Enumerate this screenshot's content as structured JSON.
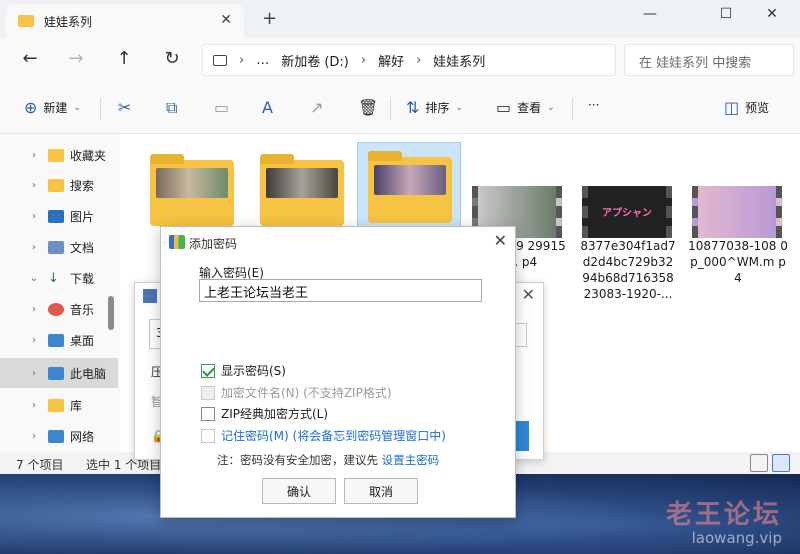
{
  "window": {
    "tab_title": "娃娃系列",
    "tab_close": "✕",
    "new_tab": "+"
  },
  "window_controls": {
    "minimize": "—",
    "maximize": "☐",
    "close": "✕"
  },
  "navigation": {
    "back": "←",
    "forward": "→",
    "up": "↑",
    "refresh": "↻"
  },
  "address": {
    "more": "…",
    "separator": "›",
    "path": [
      "新加卷 (D:)",
      "解好",
      "娃娃系列"
    ],
    "search_placeholder": "在 娃娃系列 中搜索"
  },
  "toolbar": {
    "new_label": "新建",
    "sort_label": "排序",
    "view_label": "查看",
    "more_label": "···",
    "preview_label": "预览",
    "cut_icon": "cut-icon",
    "copy_icon": "copy-icon",
    "paste_icon": "paste-icon",
    "rename_icon": "rename-icon",
    "share_icon": "share-icon",
    "delete_icon": "delete-icon"
  },
  "sidebar": {
    "items": [
      {
        "label": "收藏夹",
        "icon": "folder-icon",
        "expanded": false
      },
      {
        "label": "搜索",
        "icon": "folder-icon",
        "expanded": false
      },
      {
        "label": "图片",
        "icon": "pictures-icon",
        "expanded": false
      },
      {
        "label": "文档",
        "icon": "documents-icon",
        "expanded": false
      },
      {
        "label": "下载",
        "icon": "downloads-icon",
        "expanded": true
      },
      {
        "label": "音乐",
        "icon": "music-icon",
        "expanded": false
      },
      {
        "label": "桌面",
        "icon": "desktop-icon",
        "expanded": false
      },
      {
        "label": "此电脑",
        "icon": "pc-icon",
        "expanded": false,
        "selected": true
      },
      {
        "label": "库",
        "icon": "library-icon",
        "expanded": false
      },
      {
        "label": "网络",
        "icon": "network-icon",
        "expanded": false
      }
    ]
  },
  "files": {
    "folders": [
      {
        "type": "folder",
        "selected": false
      },
      {
        "type": "folder",
        "selected": false
      },
      {
        "type": "folder",
        "selected": true
      }
    ],
    "videos": [
      {
        "name": "…8230339…2991544.…p4",
        "visible": "8230339 2991544. p4"
      },
      {
        "name": "8377e304f1ad7d2d4bc729b3294b68d71635823083-1920-…",
        "visible": "8377e304f1ad7 d2d4bc729b32 94b68d716358 23083-1920-..."
      },
      {
        "name": "10877038-1080p_000^WM.mp4",
        "visible": "10877038-108 0p_000^WM.m p4"
      }
    ],
    "video2_title": "アプシャン"
  },
  "status": {
    "count": "7 个项目",
    "selected": "选中 1 个项目"
  },
  "bg_dialog": {
    "input_value": "3",
    "line1": "压",
    "line2": "智"
  },
  "dialog": {
    "title": "添加密码",
    "close": "✕",
    "input_label": "输入密码(E)",
    "password_value": "上老王论坛当老王",
    "options": [
      {
        "label": "显示密码(S)",
        "checked": true,
        "disabled": false
      },
      {
        "label": "加密文件名(N) (不支持ZIP格式)",
        "checked": false,
        "disabled": true
      },
      {
        "label": "ZIP经典加密方式(L)",
        "checked": false,
        "disabled": false
      },
      {
        "label": "记住密码(M) (将会备忘到密码管理窗口中)",
        "checked": false,
        "disabled": false,
        "link": true
      }
    ],
    "note_prefix": "注：密码没有安全加密，建议先",
    "note_link": "设置主密码",
    "ok_label": "确认",
    "cancel_label": "取消"
  },
  "watermark": {
    "line1": "老王论坛",
    "line2": "laowang.vip"
  },
  "corner_logo": "S"
}
